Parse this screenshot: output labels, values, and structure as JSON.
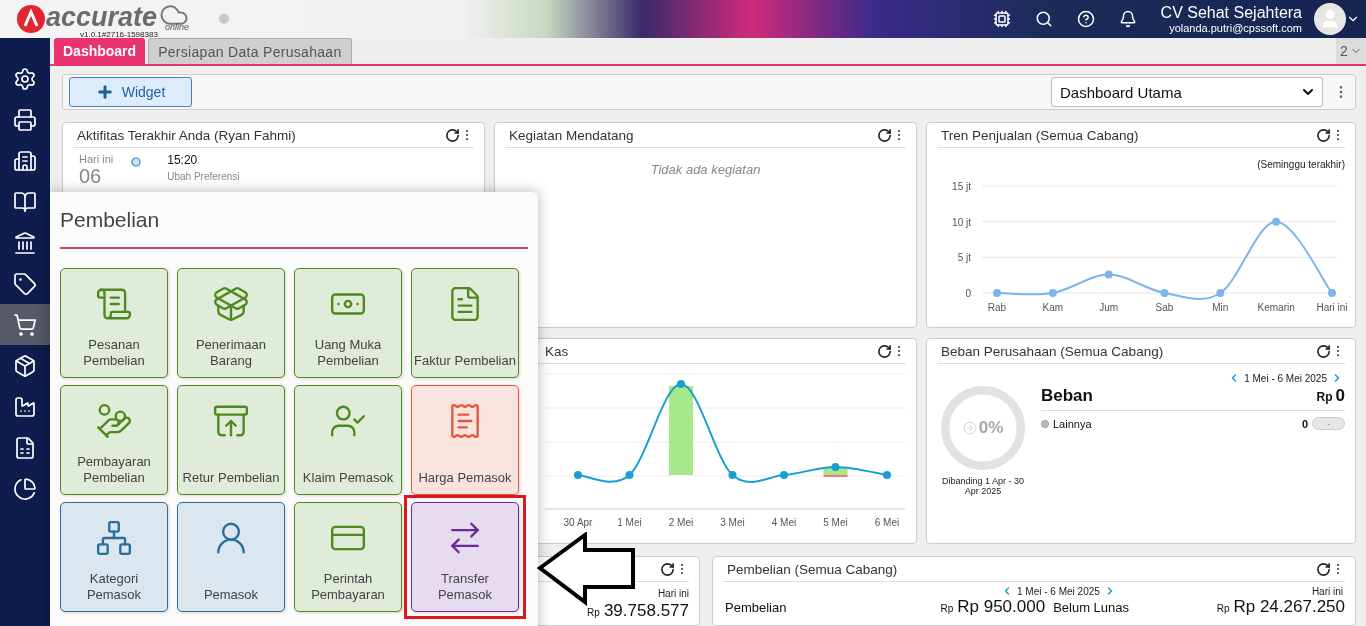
{
  "header": {
    "logo_text": "accurate",
    "logo_sub": "online",
    "version": "v1.0.1#2716-1598383",
    "company": "CV Sehat Sejahtera",
    "email": "yolanda.putri@cpssoft.com"
  },
  "sidebar": {
    "items": [
      {
        "selected": false
      },
      {
        "selected": false
      },
      {
        "selected": false
      },
      {
        "selected": false
      },
      {
        "selected": false
      },
      {
        "selected": false
      },
      {
        "selected": true
      },
      {
        "selected": false
      },
      {
        "selected": false
      },
      {
        "selected": false
      },
      {
        "selected": false
      }
    ]
  },
  "tabs": [
    {
      "label": "Dashboard",
      "selected": true
    },
    {
      "label": "Persiapan Data Perusahaan",
      "selected": false
    }
  ],
  "tab_count": "2",
  "toolbar": {
    "add_button": "Widget",
    "dashboard_select": "Dashboard Utama"
  },
  "activity": {
    "title": "Aktifitas Terakhir Anda (Ryan Fahmi)",
    "day_label": "Hari ini",
    "day": "06",
    "time": "15:20",
    "note": "Ubah Preferensi"
  },
  "upcoming": {
    "title": "Kegiatan Mendatang",
    "empty_text": "Tidak ada kegiatan"
  },
  "sales_trend": {
    "title": "Tren Penjualan (Semua Cabang)",
    "period": "(Seminggu terakhir)",
    "chart_data": {
      "type": "line",
      "categories": [
        "Rab",
        "Kam",
        "Jum",
        "Sab",
        "Min",
        "Kemarin",
        "Hari ini"
      ],
      "series": [
        {
          "color": "#7cb5ec",
          "marker": true,
          "values": [
            0,
            0,
            2.6,
            0,
            0,
            10,
            0
          ]
        }
      ],
      "ylim": [
        0,
        15
      ],
      "yticks": [
        {
          "value": 0,
          "label": "0"
        },
        {
          "value": 5,
          "label": "5 jt"
        },
        {
          "value": 10,
          "label": "10 jt"
        },
        {
          "value": 15,
          "label": "15 jt"
        }
      ]
    }
  },
  "cash": {
    "title": "Kas",
    "x_labels": [
      "30 Apr",
      "1 Mei",
      "2 Mei",
      "3 Mei",
      "4 Mei",
      "5 Mei",
      "6 Mei"
    ]
  },
  "expenses": {
    "title": "Beban Perusahaan (Semua Cabang)",
    "date_range": "1 Mei - 6 Mei 2025",
    "percent": "0%",
    "level": 0,
    "compare": "Dibanding 1 Apr - 30 Apr 2025",
    "heading": "Beban",
    "currency": "Rp",
    "total": "0",
    "items": [
      {
        "label": "Lainnya",
        "color": "#bdbdbd",
        "value": "0",
        "badge": "-"
      }
    ]
  },
  "cash_today": {
    "period": "Hari ini",
    "currency": "Rp",
    "amount": "39.758.577"
  },
  "purchases": {
    "title": "Pembelian (Semua Cabang)",
    "date_range": "1 Mei - 6 Mei 2025",
    "period": "Hari ini",
    "stats": [
      {
        "label": "Pembelian",
        "currency": "Rp",
        "amount": "Rp 950.000"
      },
      {
        "label": "Belum Lunas",
        "currency": "Rp",
        "amount": "Rp 24.267.250"
      }
    ]
  },
  "menu": {
    "title": "Pembelian",
    "tiles": [
      {
        "label": "Pesanan Pembelian",
        "color": "#4e8a1e",
        "highlighted": false
      },
      {
        "label": "Penerimaan Barang",
        "color": "#4e8a1e",
        "highlighted": false
      },
      {
        "label": "Uang Muka Pembelian",
        "color": "#4e8a1e",
        "highlighted": false
      },
      {
        "label": "Faktur Pembelian",
        "color": "#4e8a1e",
        "highlighted": false
      },
      {
        "label": "Pembayaran Pembelian",
        "color": "#4e8a1e",
        "highlighted": false
      },
      {
        "label": "Retur Pembelian",
        "color": "#4e8a1e",
        "highlighted": false
      },
      {
        "label": "Klaim Pemasok",
        "color": "#4e8a1e",
        "highlighted": false
      },
      {
        "label": "Harga Pemasok",
        "color": "#e05a3a",
        "highlighted": false
      },
      {
        "label": "Kategori Pemasok",
        "color": "#2a6e9e",
        "highlighted": false
      },
      {
        "label": "Pemasok",
        "color": "#2a6e9e",
        "highlighted": false
      },
      {
        "label": "Perintah Pembayaran",
        "color": "#4e8a1e",
        "highlighted": false
      },
      {
        "label": "Transfer Pemasok",
        "color": "#6a2a9e",
        "highlighted": true
      }
    ]
  }
}
